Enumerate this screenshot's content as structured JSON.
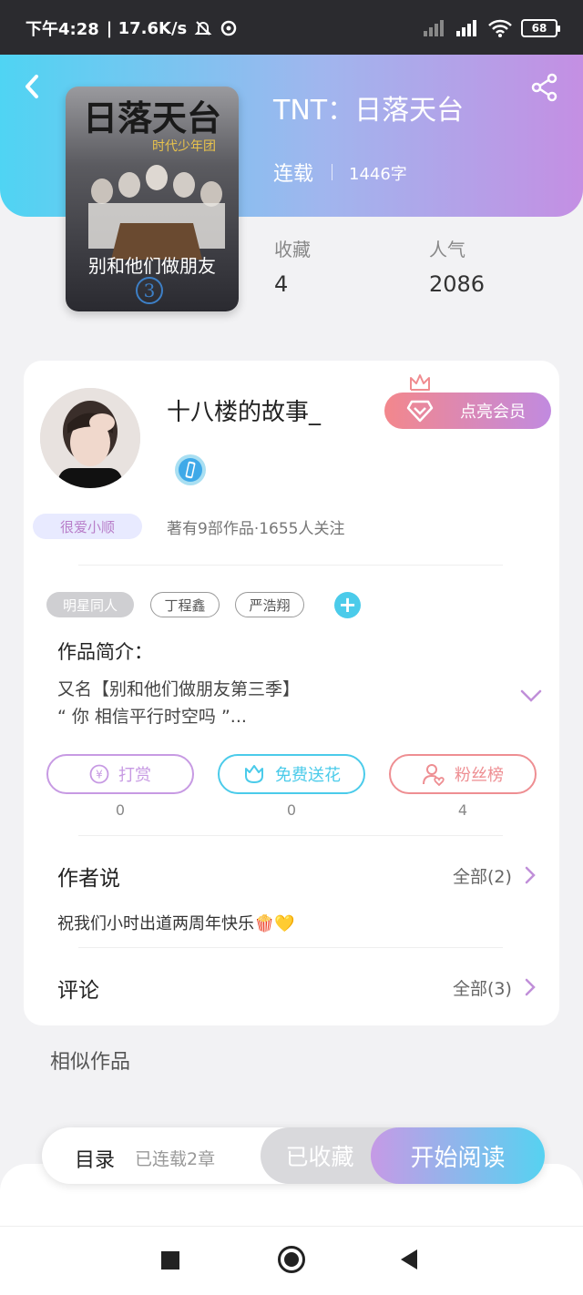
{
  "status_bar": {
    "time": "下午4:28",
    "speed": "| 17.6K/s",
    "battery": "68"
  },
  "book": {
    "title": "TNT：日落天台",
    "status": "连载",
    "words": "1446字",
    "cover": {
      "title_text": "日落天台",
      "subtitle_text": "时代少年团",
      "tagline_text": "别和他们做朋友",
      "number_text": "3"
    }
  },
  "stats": {
    "favorites_label": "收藏",
    "favorites_value": "4",
    "popularity_label": "人气",
    "popularity_value": "2086"
  },
  "author": {
    "name": "十八楼的故事_",
    "vip_label": "点亮会员",
    "fan_tag": "很爱小顺",
    "meta": "著有9部作品·1655人关注"
  },
  "tags": [
    "明星同人",
    "丁程鑫",
    "严浩翔"
  ],
  "intro": {
    "title": "作品简介：",
    "line1": "又名【别和他们做朋友第三季】",
    "line2": "“ 你 相信平行时空吗 ”..."
  },
  "actions": [
    {
      "label": "打赏",
      "count": "0",
      "color": "#c79ae3"
    },
    {
      "label": "免费送花",
      "count": "0",
      "color": "#4bcbea"
    },
    {
      "label": "粉丝榜",
      "count": "4",
      "color": "#ee8e92"
    }
  ],
  "author_say": {
    "title": "作者说",
    "more": "全部(2)",
    "text": "祝我们小时出道两周年快乐🍿💛"
  },
  "comments": {
    "title": "评论",
    "more": "全部(3)"
  },
  "similar_title": "相似作品",
  "bottom": {
    "toc": "目录",
    "toc_sub": "已连载2章",
    "fav": "已收藏",
    "read": "开始阅读"
  }
}
